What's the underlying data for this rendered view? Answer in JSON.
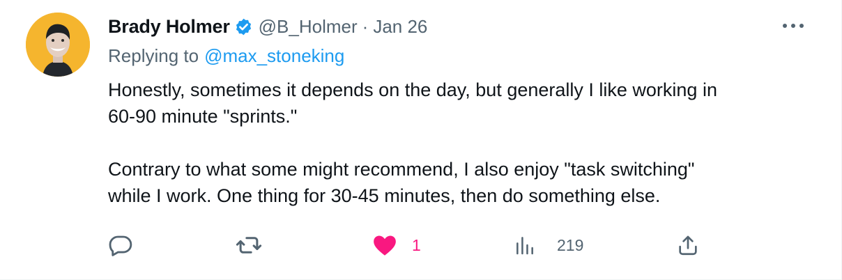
{
  "tweet": {
    "author": {
      "display_name": "Brady Holmer",
      "handle": "@B_Holmer",
      "verified": true
    },
    "separator": "·",
    "date": "Jan 26",
    "reply": {
      "prefix": "Replying to",
      "mention": "@max_stoneking"
    },
    "text": {
      "line1": "Honestly, sometimes it depends on the day, but generally I like working in",
      "line2": "60-90 minute \"sprints.\"",
      "line3": "Contrary to what some might recommend, I also enjoy \"task switching\"",
      "line4": "while I work. One thing for 30-45 minutes, then do something else."
    },
    "actions": {
      "likes": "1",
      "views": "219"
    },
    "icons": {
      "more": "more-options-icon",
      "reply": "reply-icon",
      "retweet": "retweet-icon",
      "like": "heart-icon",
      "views": "views-chart-icon",
      "share": "share-icon",
      "verified": "verified-badge-icon"
    },
    "colors": {
      "text": "#0f1419",
      "secondary": "#536471",
      "link": "#1d9bf0",
      "like": "#f91880",
      "avatar_bg": "#f5b52e"
    }
  }
}
